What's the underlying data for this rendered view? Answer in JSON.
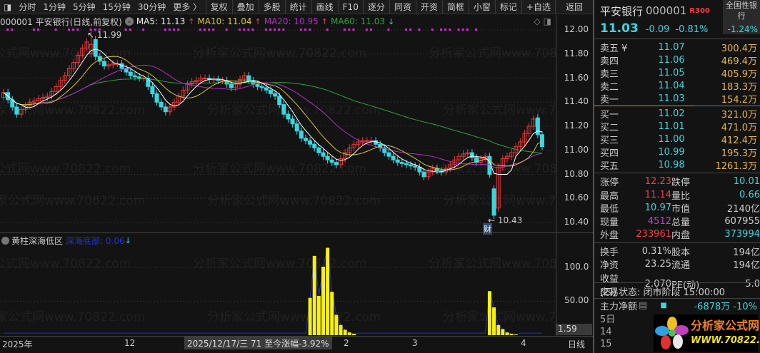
{
  "toolbar": {
    "periods": [
      "分时",
      "1分钟",
      "5分钟",
      "15分钟",
      "30分钟",
      "更多 〉"
    ],
    "buttons": [
      "复权",
      "叠加",
      "多股",
      "统计",
      "画线",
      "F10",
      "逐分",
      "同资",
      "开资",
      "简框",
      "小窗",
      "标记",
      "+自选",
      "返回"
    ]
  },
  "header": {
    "code_name": "000001 平安银行(日线,前复权)",
    "ma5": "MA5: 11.13",
    "ma10": "MA10: 11.04",
    "ma20": "MA20: 10.95",
    "ma60": "MA60: 11.03",
    "up": "↑",
    "down": "↓"
  },
  "price_axis": [
    "12.00",
    "11.80",
    "11.60",
    "11.40",
    "11.20",
    "11.00",
    "10.80",
    "10.60",
    "10.40"
  ],
  "annotations": {
    "high": "11.99",
    "low": "10.43",
    "cai": "财"
  },
  "watermark": "分析家公式网www.70822.com",
  "chart_data": {
    "type": "candlestick",
    "ylim": [
      10.38,
      12.02
    ],
    "opens": [
      11.44,
      11.48,
      11.42,
      11.36,
      11.3,
      11.34,
      11.37,
      11.4,
      11.41,
      11.43,
      11.44,
      11.45,
      11.49,
      11.53,
      11.58,
      11.62,
      11.68,
      11.73,
      11.79,
      11.85,
      11.8,
      11.92,
      11.78,
      11.74,
      11.7,
      11.71,
      11.72,
      11.72,
      11.68,
      11.65,
      11.62,
      11.61,
      11.6,
      11.6,
      11.53,
      11.47,
      11.4,
      11.36,
      11.32,
      11.36,
      11.4,
      11.45,
      11.5,
      11.55,
      11.57,
      11.58,
      11.6,
      11.6,
      11.59,
      11.59,
      11.58,
      11.58,
      11.55,
      11.52,
      11.55,
      11.59,
      11.62,
      11.58,
      11.55,
      11.53,
      11.52,
      11.5,
      11.47,
      11.45,
      11.38,
      11.3,
      11.26,
      11.22,
      11.16,
      11.1,
      11.08,
      11.05,
      11.02,
      10.98,
      10.95,
      10.92,
      10.9,
      10.88,
      10.93,
      10.98,
      11.02,
      11.05,
      11.07,
      11.08,
      11.08,
      11.08,
      11.05,
      11.02,
      10.98,
      10.95,
      10.92,
      10.9,
      10.89,
      10.88,
      10.87,
      10.86,
      10.82,
      10.78,
      10.82,
      10.85,
      10.83,
      10.82,
      10.85,
      10.88,
      10.92,
      10.95,
      10.97,
      10.98,
      10.94,
      10.9,
      10.93,
      10.95,
      10.68,
      10.52,
      10.86,
      10.93,
      10.95,
      10.98,
      11.03,
      11.07,
      11.14,
      11.2,
      11.27,
      11.13
    ],
    "closes": [
      11.48,
      11.42,
      11.36,
      11.3,
      11.34,
      11.37,
      11.4,
      11.41,
      11.43,
      11.44,
      11.45,
      11.49,
      11.53,
      11.58,
      11.62,
      11.68,
      11.73,
      11.79,
      11.85,
      11.9,
      11.88,
      11.78,
      11.74,
      11.7,
      11.71,
      11.72,
      11.72,
      11.68,
      11.65,
      11.62,
      11.61,
      11.6,
      11.6,
      11.53,
      11.47,
      11.4,
      11.36,
      11.32,
      11.36,
      11.4,
      11.45,
      11.5,
      11.55,
      11.57,
      11.58,
      11.6,
      11.6,
      11.59,
      11.59,
      11.58,
      11.58,
      11.55,
      11.52,
      11.55,
      11.59,
      11.62,
      11.58,
      11.55,
      11.53,
      11.52,
      11.5,
      11.47,
      11.45,
      11.38,
      11.3,
      11.26,
      11.22,
      11.16,
      11.1,
      11.08,
      11.05,
      11.02,
      10.98,
      10.95,
      10.92,
      10.9,
      10.88,
      10.93,
      10.98,
      11.02,
      11.05,
      11.07,
      11.08,
      11.08,
      11.08,
      11.05,
      11.02,
      10.98,
      10.95,
      10.92,
      10.9,
      10.89,
      10.88,
      10.87,
      10.86,
      10.82,
      10.78,
      10.82,
      10.85,
      10.83,
      10.82,
      10.85,
      10.88,
      10.92,
      10.95,
      10.97,
      10.98,
      10.94,
      10.9,
      10.93,
      10.95,
      10.8,
      10.46,
      10.86,
      10.93,
      10.95,
      10.98,
      11.03,
      11.07,
      11.14,
      11.2,
      11.26,
      11.13,
      11.03
    ],
    "signal_marks": [
      1,
      2,
      7,
      8,
      12,
      15,
      16,
      17,
      20,
      21,
      22,
      28,
      29,
      32,
      37,
      38,
      39,
      40,
      45,
      46,
      47,
      48,
      51,
      54,
      55,
      56,
      57,
      60,
      61,
      62,
      63,
      64,
      68,
      69,
      70,
      74,
      78,
      79,
      80,
      83,
      84,
      88,
      92,
      93,
      95,
      98,
      100,
      101,
      102,
      104,
      105,
      106,
      108
    ]
  },
  "indicator": {
    "title": "黄柱深海低区",
    "series_label": "深海底部: 0.06",
    "axis": [
      "100.0",
      "50.00"
    ],
    "current": "1.59",
    "chart_data": {
      "type": "bar",
      "ylim": [
        0,
        140
      ],
      "bars": [
        {
          "start": 70,
          "values": [
            55,
            117,
            58,
            101,
            129,
            64,
            30,
            15,
            8,
            4,
            2
          ]
        },
        {
          "start": 111,
          "values": [
            65,
            41,
            15,
            9,
            4,
            2,
            1
          ]
        }
      ],
      "baseline": 3
    }
  },
  "xaxis": {
    "labels": [
      "2025年",
      "12",
      "2",
      "3",
      "4"
    ],
    "period": "日线",
    "tooltip": "2025/12/17/三 71 至今涨幅-3.92%"
  },
  "quote": {
    "name": "平安银行",
    "code": "000001",
    "tag": "R300",
    "industry": "全国性银行",
    "industry_change": "-1.24%",
    "price": "11.03",
    "change": "-0.09",
    "pct": "-0.81%"
  },
  "orderbook": {
    "asks": [
      [
        "卖五 ¥",
        "11.07",
        "300.4万"
      ],
      [
        "卖四",
        "11.06",
        "469.4万"
      ],
      [
        "卖三",
        "11.05",
        "405.9万"
      ],
      [
        "卖二",
        "11.04",
        "183.3万"
      ],
      [
        "卖一",
        "11.03",
        "154.2万"
      ]
    ],
    "bids": [
      [
        "买一",
        "11.02",
        "321.0万"
      ],
      [
        "买二",
        "11.01",
        "471.0万"
      ],
      [
        "买三",
        "11.00",
        "412.4万"
      ],
      [
        "买四",
        "10.99",
        "195.3万"
      ],
      [
        "买五",
        "10.98",
        "1261.3万"
      ]
    ]
  },
  "stats": [
    [
      "涨停",
      "12.23",
      "跌停",
      "10.01"
    ],
    [
      "最高",
      "11.14",
      "量比",
      "0.66"
    ],
    [
      "最低",
      "10.97",
      "市值",
      "2140亿"
    ],
    [
      "现量",
      "4512",
      "总量",
      "607955"
    ],
    [
      "外盘",
      "233961",
      "内盘",
      "373994"
    ]
  ],
  "stats2": [
    [
      "换手",
      "0.31%",
      "股本",
      "194亿"
    ],
    [
      "净资",
      "23.25",
      "流通",
      "194亿"
    ],
    [
      "收益(四)",
      "2.070",
      "PE(动)",
      "5.0"
    ]
  ],
  "status": "交易状态: 闭市阶段 15:00:00",
  "capital": {
    "label": "主力净额",
    "value": "-6878万",
    "pct": "-10%"
  },
  "partial_rows": [
    "5日",
    "14",
    "15"
  ],
  "logo": {
    "cn": "分析家公式网",
    "url": "WWW.70822.COM"
  }
}
